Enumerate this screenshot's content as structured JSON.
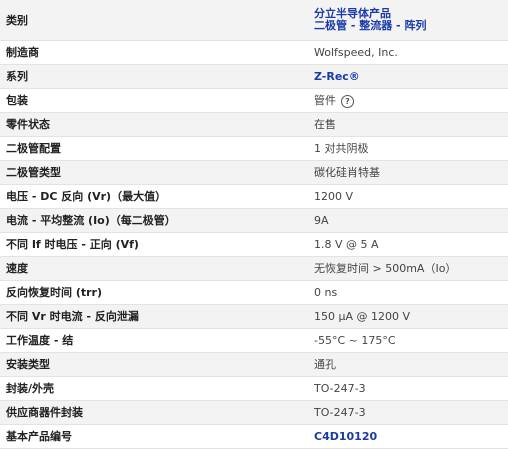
{
  "rows": [
    {
      "label": "类别",
      "value_lines": [
        "分立半导体产品",
        "二极管 - 整流器 - 阵列"
      ]
    },
    {
      "label": "制造商",
      "value": "Wolfspeed, Inc."
    },
    {
      "label": "系列",
      "value": "Z-Rec®"
    },
    {
      "label": "包装",
      "value": "管件",
      "icon": "help-circle-icon"
    },
    {
      "label": "零件状态",
      "value": "在售"
    },
    {
      "label": "二极管配置",
      "value": "1 对共阴极"
    },
    {
      "label": "二极管类型",
      "value": "碳化硅肖特基"
    },
    {
      "label": "电压 - DC 反向 (Vr)（最大值）",
      "value": "1200 V"
    },
    {
      "label": "电流 - 平均整流 (Io)（每二极管）",
      "value": "9A"
    },
    {
      "label": "不同 If 时电压 - 正向 (Vf)",
      "value": "1.8 V @ 5 A"
    },
    {
      "label": "速度",
      "value": "无恢复时间 > 500mA（Io）"
    },
    {
      "label": "反向恢复时间 (trr)",
      "value": "0 ns"
    },
    {
      "label": "不同 Vr 时电流 - 反向泄漏",
      "value": "150 µA @ 1200 V"
    },
    {
      "label": "工作温度 - 结",
      "value": "-55°C ~ 175°C"
    },
    {
      "label": "安装类型",
      "value": "通孔"
    },
    {
      "label": "封装/外壳",
      "value": "TO-247-3"
    },
    {
      "label": "供应商器件封装",
      "value": "TO-247-3"
    },
    {
      "label": "基本产品编号",
      "value": "C4D10120"
    }
  ],
  "colors": {
    "link": "#1a3aa8",
    "row_alt": "#f3f3f3",
    "border": "#e3e3e3"
  }
}
